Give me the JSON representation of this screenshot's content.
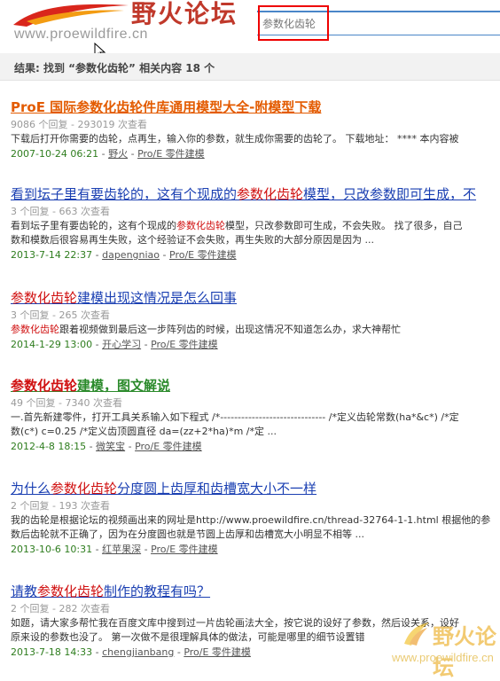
{
  "header": {
    "logo_text": "野火论坛",
    "logo_url": "www.proewildfire.cn",
    "search_placeholder": "参数化齿轮"
  },
  "result_summary": "结果: 找到 “参数化齿轮” 相关内容 18 个",
  "results": [
    {
      "title": "ProE 国际参数化齿轮件库通用模型大全-附模型下载",
      "stats": "9086 个回复 - 293019 次查看",
      "snippet": "下载后打开你需要的齿轮，点再生，输入你的参数，就生成你需要的齿轮了。 下载地址： **** 本内容被",
      "date": "2007-10-24 06:21",
      "author": "野火",
      "forum": "Pro/E 零件建模"
    },
    {
      "title_pre": "看到坛子里有要齿轮的，这有个现成的",
      "title_kw": "参数化齿轮",
      "title_post": "模型，只改参数即可生成，不",
      "stats": "3 个回复 - 663 次查看",
      "snippet1_pre": "看到坛子里有要齿轮的，这有个现成的",
      "snippet1_kw": "参数化齿轮",
      "snippet1_post": "模型，只改参数即可生成，不会失败。 找了很多，自己",
      "snippet2": "数和模数后很容易再生失败，这个经验证不会失败，再生失败的大部分原因是因为 ...",
      "date": "2013-7-14 22:37",
      "author": "dapengniao",
      "forum": "Pro/E 零件建模"
    },
    {
      "title_kw": "参数化齿轮",
      "title_post": "建模出现这情况是怎么回事",
      "stats": "3 个回复 - 265 次查看",
      "snippet_kw": "参数化齿轮",
      "snippet_post": "跟着视频做到最后这一步阵列齿的时候，出现这情况不知道怎么办，求大神帮忙",
      "date": "2014-1-29 13:00",
      "author": "开心学习",
      "forum": "Pro/E 零件建模"
    },
    {
      "title_kw": "参数化齿轮",
      "title_post": "建模，图文解说",
      "stats": "49 个回复 - 7340 次查看",
      "snippet1": "一.首先新建零件，打开工具关系输入如下程式 /*------------------------------ /*定义齿轮常数(ha*&c*) /*定",
      "snippet2": "数(c*) c=0.25 /*定义齿顶圆直径 da=(zz+2*ha)*m /*定 ...",
      "date": "2012-4-8 18:15",
      "author": "微笑宝",
      "forum": "Pro/E 零件建模"
    },
    {
      "title_pre": "为什么",
      "title_kw": "参数化齿轮",
      "title_post": "分度圆上齿厚和齿槽宽大小不一样",
      "stats": "2 个回复 - 193 次查看",
      "snippet1": "我的齿轮是根据论坛的视频画出来的网址是http://www.proewildfire.cn/thread-32764-1-1.html 根据他的参",
      "snippet2": "数后齿轮就不正确了，因为在分度圆也就是节圆上齿厚和齿槽宽大小明显不相等 ...",
      "date": "2013-10-6 10:31",
      "author": "红苹果深",
      "forum": "Pro/E 零件建模"
    },
    {
      "title_pre": "请教",
      "title_kw": "参数化齿轮",
      "title_post": "制作的教程有吗？",
      "stats": "2 个回复 - 282 次查看",
      "snippet1": "如题，请大家多帮忙我在百度文库中搜到过一片齿轮画法大全，按它说的设好了参数，然后设关系，设好",
      "snippet2": "原来设的参数也没了。 第一次做不是很理解具体的做法，可能是哪里的细节设置错",
      "date": "2013-7-18 14:33",
      "author": "chengjianbang",
      "forum": "Pro/E 零件建模"
    }
  ],
  "watermark": {
    "text": "野火论坛",
    "url": "www.proewildfire.cn"
  },
  "colors": {
    "link_blue": "#1a3fb2",
    "keyword_red": "#d01010",
    "date_green": "#2e7d1e",
    "highlight_box": "#e00000",
    "search_border": "#4a86c8"
  }
}
